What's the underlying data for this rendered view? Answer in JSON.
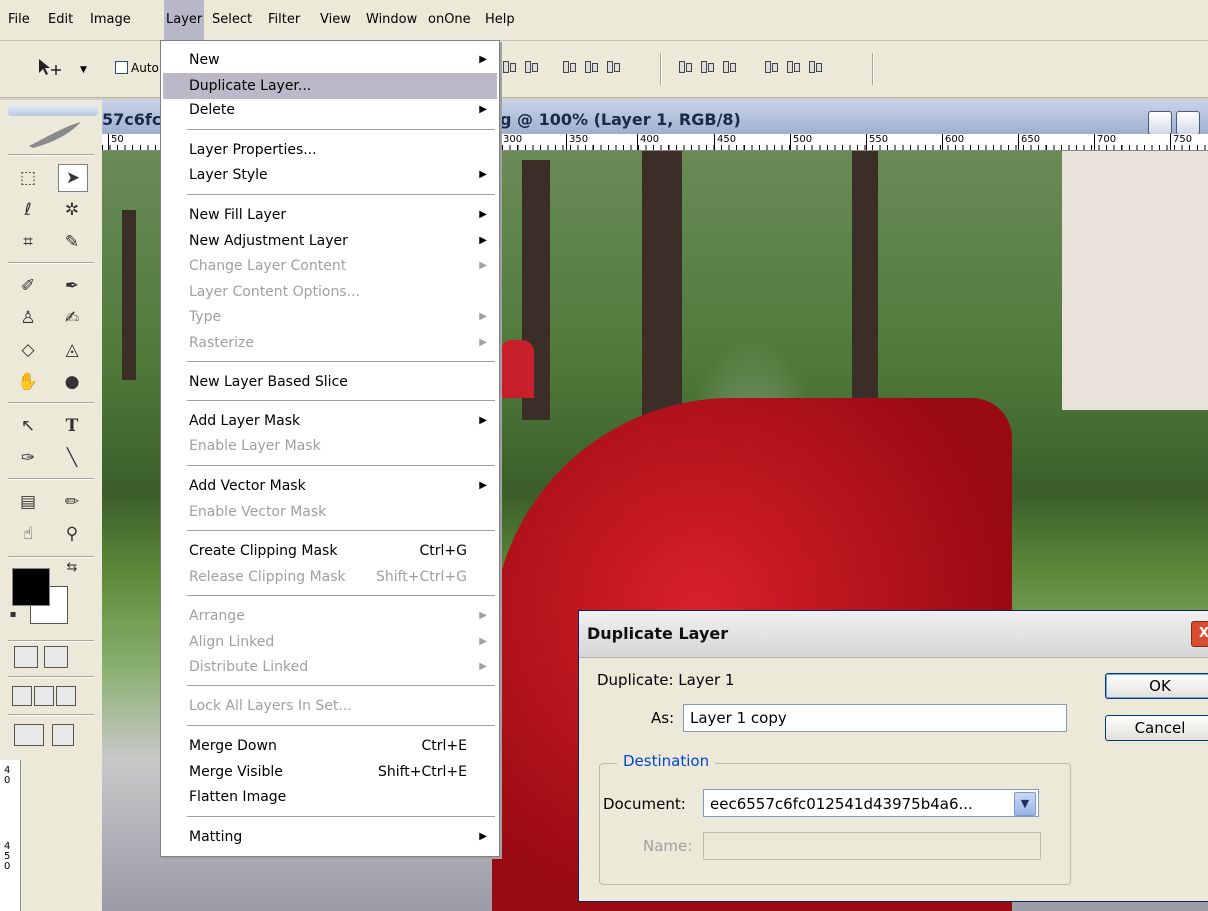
{
  "menubar": {
    "items": [
      "File",
      "Edit",
      "Image",
      "Layer",
      "Select",
      "Filter",
      "View",
      "Window",
      "onOne",
      "Help"
    ],
    "active": "Layer"
  },
  "optionsbar": {
    "auto_label": "Auto"
  },
  "document": {
    "title_left": "57c6fc",
    "title_right": "g @ 100% (Layer 1, RGB/8)",
    "ruler_h": [
      "50",
      "300",
      "350",
      "400",
      "450",
      "500",
      "550",
      "600",
      "650",
      "700",
      "750"
    ],
    "ruler_v": [
      "4\n0",
      "4\n5\n0"
    ]
  },
  "layer_menu": {
    "items": [
      {
        "label": "New",
        "submenu": true
      },
      {
        "label": "Duplicate Layer...",
        "highlighted": true
      },
      {
        "label": "Delete",
        "submenu": true
      },
      {
        "label": "Layer Properties..."
      },
      {
        "label": "Layer Style",
        "submenu": true
      },
      {
        "label": "New Fill Layer",
        "submenu": true
      },
      {
        "label": "New Adjustment Layer",
        "submenu": true
      },
      {
        "label": "Change Layer Content",
        "submenu": true,
        "disabled": true
      },
      {
        "label": "Layer Content Options...",
        "disabled": true
      },
      {
        "label": "Type",
        "submenu": true,
        "disabled": true
      },
      {
        "label": "Rasterize",
        "submenu": true,
        "disabled": true
      },
      {
        "label": "New Layer Based Slice"
      },
      {
        "label": "Add Layer Mask",
        "submenu": true
      },
      {
        "label": "Enable Layer Mask",
        "disabled": true
      },
      {
        "label": "Add Vector Mask",
        "submenu": true
      },
      {
        "label": "Enable Vector Mask",
        "disabled": true
      },
      {
        "label": "Create Clipping Mask",
        "shortcut": "Ctrl+G"
      },
      {
        "label": "Release Clipping Mask",
        "shortcut": "Shift+Ctrl+G",
        "disabled": true
      },
      {
        "label": "Arrange",
        "submenu": true,
        "disabled": true
      },
      {
        "label": "Align Linked",
        "submenu": true,
        "disabled": true
      },
      {
        "label": "Distribute Linked",
        "submenu": true,
        "disabled": true
      },
      {
        "label": "Lock All Layers In Set...",
        "disabled": true
      },
      {
        "label": "Merge Down",
        "shortcut": "Ctrl+E"
      },
      {
        "label": "Merge Visible",
        "shortcut": "Shift+Ctrl+E"
      },
      {
        "label": "Flatten Image"
      },
      {
        "label": "Matting",
        "submenu": true
      }
    ]
  },
  "dialog": {
    "title": "Duplicate Layer",
    "close_glyph": "X",
    "duplicate_text": "Duplicate: Layer 1",
    "as_label": "As:",
    "as_value": "Layer 1 copy",
    "destination_legend": "Destination",
    "document_label": "Document:",
    "document_value": "eec6557c6fc012541d43975b4a6...",
    "name_label": "Name:",
    "name_value": "",
    "ok_label": "OK",
    "cancel_label": "Cancel"
  }
}
